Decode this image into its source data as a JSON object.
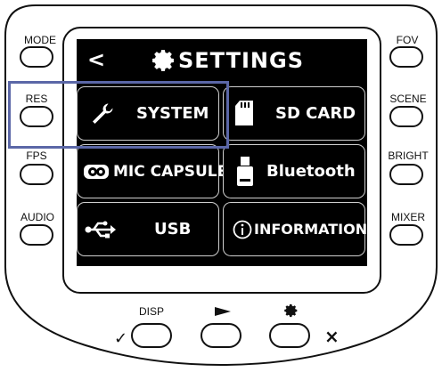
{
  "screen": {
    "back_label": "<",
    "title": "SETTINGS",
    "tiles": [
      {
        "label": "SYSTEM",
        "icon": "wrench-icon"
      },
      {
        "label": "SD CARD",
        "icon": "sd-card-icon"
      },
      {
        "label": "MIC CAPSULE",
        "icon": "mic-capsule-icon"
      },
      {
        "label": "Bluetooth",
        "icon": "bluetooth-dongle-icon"
      },
      {
        "label": "USB",
        "icon": "usb-icon"
      },
      {
        "label": "INFORMATION",
        "icon": "info-icon"
      }
    ]
  },
  "left_buttons": [
    {
      "label": "MODE"
    },
    {
      "label": "RES"
    },
    {
      "label": "FPS"
    },
    {
      "label": "AUDIO"
    }
  ],
  "right_buttons": [
    {
      "label": "FOV"
    },
    {
      "label": "SCENE"
    },
    {
      "label": "BRIGHT"
    },
    {
      "label": "MIXER"
    }
  ],
  "bottom_buttons": [
    {
      "label": "DISP",
      "icon": "none"
    },
    {
      "label": "",
      "icon": "play-icon"
    },
    {
      "label": "",
      "icon": "gear-icon"
    }
  ],
  "bottom_marks": {
    "confirm": "✓",
    "cancel": "×"
  },
  "colors": {
    "screen_bg": "#000000",
    "tile_border": "#cfcfcf",
    "highlight": "#5b67a7"
  }
}
